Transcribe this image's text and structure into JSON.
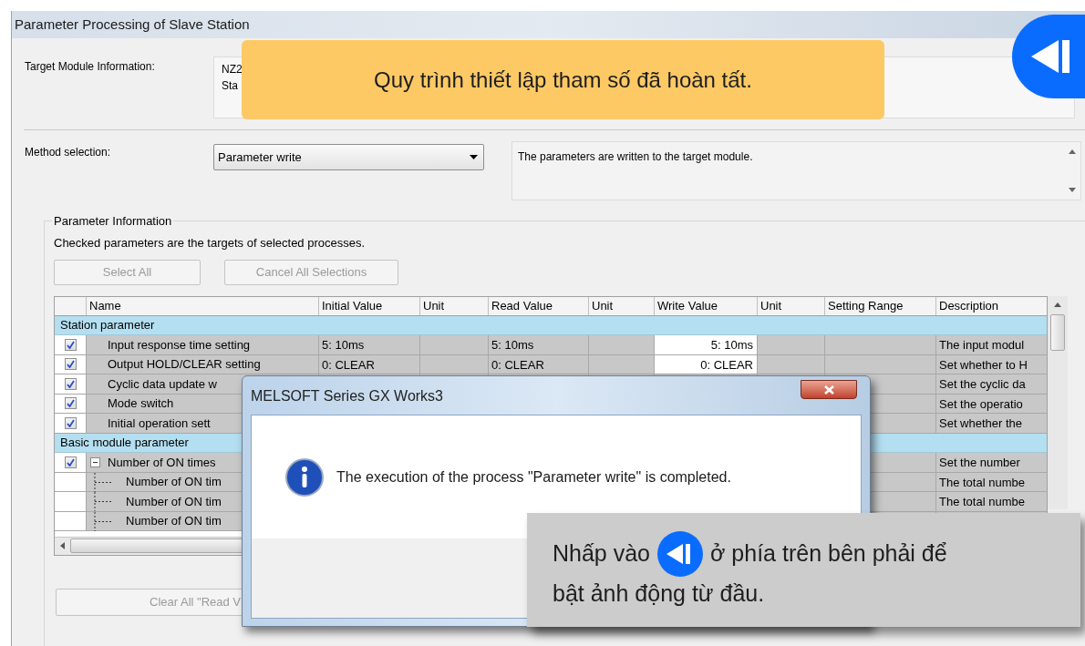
{
  "window": {
    "title": "Parameter Processing of Slave Station"
  },
  "target_module": {
    "label": "Target Module Information:",
    "lines": [
      "NZ2",
      "Sta"
    ]
  },
  "method": {
    "label": "Method selection:",
    "value": "Parameter write",
    "description": "The parameters are written to the target module."
  },
  "parameter_info": {
    "title": "Parameter Information",
    "note": "Checked parameters are the targets of selected processes.",
    "buttons": [
      {
        "label": "Select All",
        "disabled": true
      },
      {
        "label": "Cancel All Selections",
        "disabled": true
      }
    ],
    "table": {
      "columns": [
        "Name",
        "Initial Value",
        "Unit",
        "Read Value",
        "Unit",
        "Write Value",
        "Unit",
        "Setting Range",
        "Description"
      ],
      "rows": [
        {
          "kind": "group",
          "label": "Station parameter"
        },
        {
          "kind": "param",
          "checked": true,
          "name": "Input response time setting",
          "initial_value": "5: 10ms",
          "read_value": "5: 10ms",
          "write_value": "5: 10ms",
          "description": "The input modul"
        },
        {
          "kind": "param",
          "checked": true,
          "name": "Output HOLD/CLEAR setting",
          "initial_value": "0: CLEAR",
          "read_value": "0: CLEAR",
          "write_value": "0: CLEAR",
          "description": "Set whether to H"
        },
        {
          "kind": "param",
          "checked": true,
          "name": "Cyclic data update w",
          "description": "Set the cyclic da"
        },
        {
          "kind": "param",
          "checked": true,
          "name": "Mode switch",
          "description": "Set the operatio"
        },
        {
          "kind": "param",
          "checked": true,
          "name": "Initial operation sett",
          "description": "Set whether the"
        },
        {
          "kind": "group",
          "label": "Basic module parameter"
        },
        {
          "kind": "param",
          "checked": true,
          "expanded": true,
          "name": "Number of ON times",
          "description": "Set the number"
        },
        {
          "kind": "child",
          "name": "Number of ON tim",
          "description": "The total numbe"
        },
        {
          "kind": "child",
          "name": "Number of ON tim",
          "description": "The total numbe"
        },
        {
          "kind": "child",
          "name": "Number of ON tim"
        }
      ]
    },
    "clear_button": {
      "label": "Clear All \"Read V",
      "disabled": true
    }
  },
  "dialog": {
    "title": "MELSOFT Series GX Works3",
    "message": "The execution of the process \"Parameter write\" is completed."
  },
  "banner": {
    "text": "Quy trình thiết lập tham số đã hoàn tất."
  },
  "hint": {
    "before_icon": "Nhấp vào",
    "after_icon": "ở phía trên bên phải để",
    "line_2": "bật ảnh động từ đầu."
  }
}
